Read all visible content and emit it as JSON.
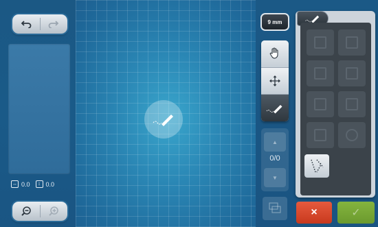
{
  "left": {
    "undo_icon": "undo-arrow-icon",
    "redo_icon": "redo-arrow-icon",
    "coord_x": "0.0",
    "coord_y": "0.0",
    "zoom_out_icon": "zoom-out-icon",
    "zoom_in_icon": "zoom-in-icon"
  },
  "tools": {
    "size_label": "9 mm",
    "page_count": "0/0"
  },
  "panel": {
    "tab_icon": "stitch-line-icon"
  },
  "actions": {
    "cancel": "×",
    "ok": "✓"
  }
}
